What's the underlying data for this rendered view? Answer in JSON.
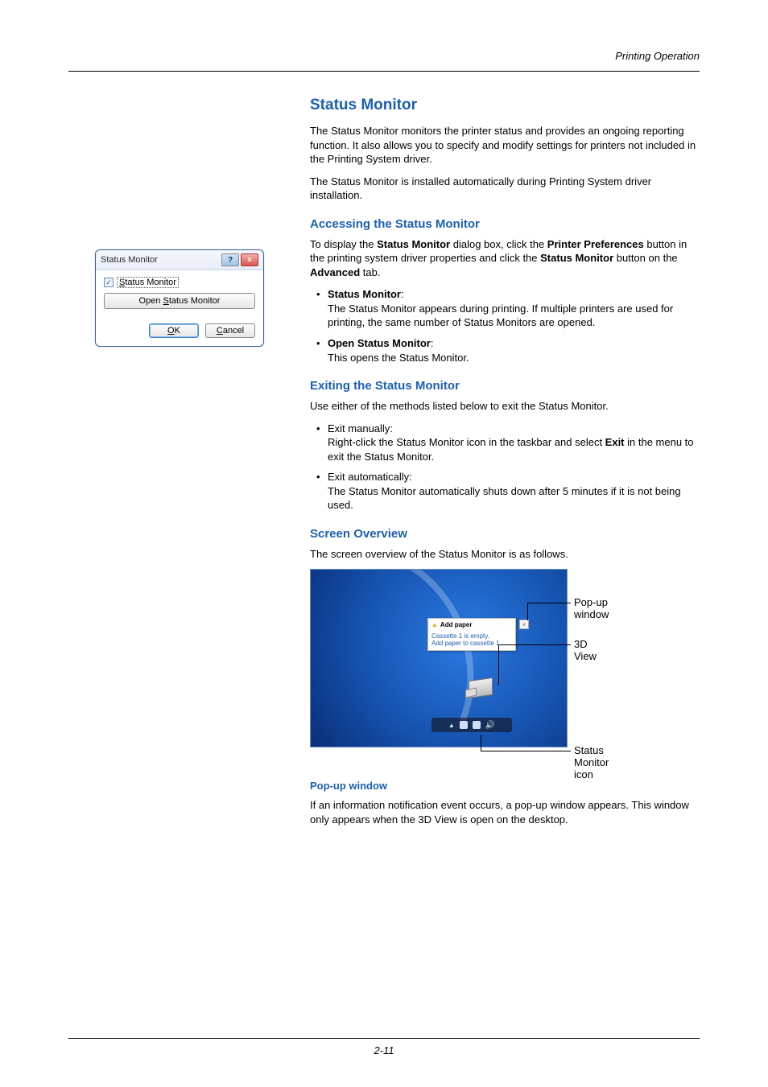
{
  "header": {
    "section": "Printing Operation"
  },
  "title": "Status Monitor",
  "intro1": "The Status Monitor monitors the printer status and provides an ongoing reporting function. It also allows you to specify and modify settings for printers not included in the Printing System driver.",
  "intro2": "The Status Monitor is installed automatically during Printing System driver installation.",
  "accessing": {
    "heading": "Accessing the Status Monitor",
    "p_pre": "To display the ",
    "p_b1": "Status Monitor",
    "p_mid1": " dialog box, click the ",
    "p_b2": "Printer Preferences",
    "p_mid2": " button in the printing system driver properties and click the ",
    "p_b3": "Status Monitor",
    "p_mid3": " button on the ",
    "p_b4": "Advanced",
    "p_post": " tab.",
    "items": [
      {
        "label": "Status Monitor",
        "desc": "The Status Monitor appears during printing. If multiple printers are used for printing, the same number of Status Monitors are opened."
      },
      {
        "label": "Open Status Monitor",
        "desc": "This opens the Status Monitor."
      }
    ]
  },
  "exiting": {
    "heading": "Exiting the Status Monitor",
    "intro": "Use either of the methods listed below to exit the Status Monitor.",
    "items": [
      {
        "label": "Exit manually:",
        "desc_pre": "Right-click the Status Monitor icon in the taskbar and select ",
        "desc_b": "Exit",
        "desc_post": " in the menu to exit the Status Monitor."
      },
      {
        "label": "Exit automatically:",
        "desc": "The Status Monitor automatically shuts down after 5 minutes if it is not being used."
      }
    ]
  },
  "overview": {
    "heading": "Screen Overview",
    "intro": "The screen overview of the Status Monitor is as follows.",
    "callouts": {
      "popup": "Pop-up window",
      "view3d": "3D View",
      "tray": "Status Monitor icon"
    },
    "popup": {
      "title": "Add paper",
      "line1": "Cassette 1 is empty.",
      "line2": "Add paper to cassette 1."
    }
  },
  "popup_section": {
    "heading": "Pop-up window",
    "text": "If an information notification event occurs, a pop-up window appears. This window only appears when the 3D View is open on the desktop."
  },
  "dialog": {
    "title": "Status Monitor",
    "checkbox": "Status Monitor",
    "open": "Open Status Monitor",
    "ok": "OK",
    "cancel": "Cancel",
    "help": "?",
    "close": "×"
  },
  "pagenum": "2-11"
}
